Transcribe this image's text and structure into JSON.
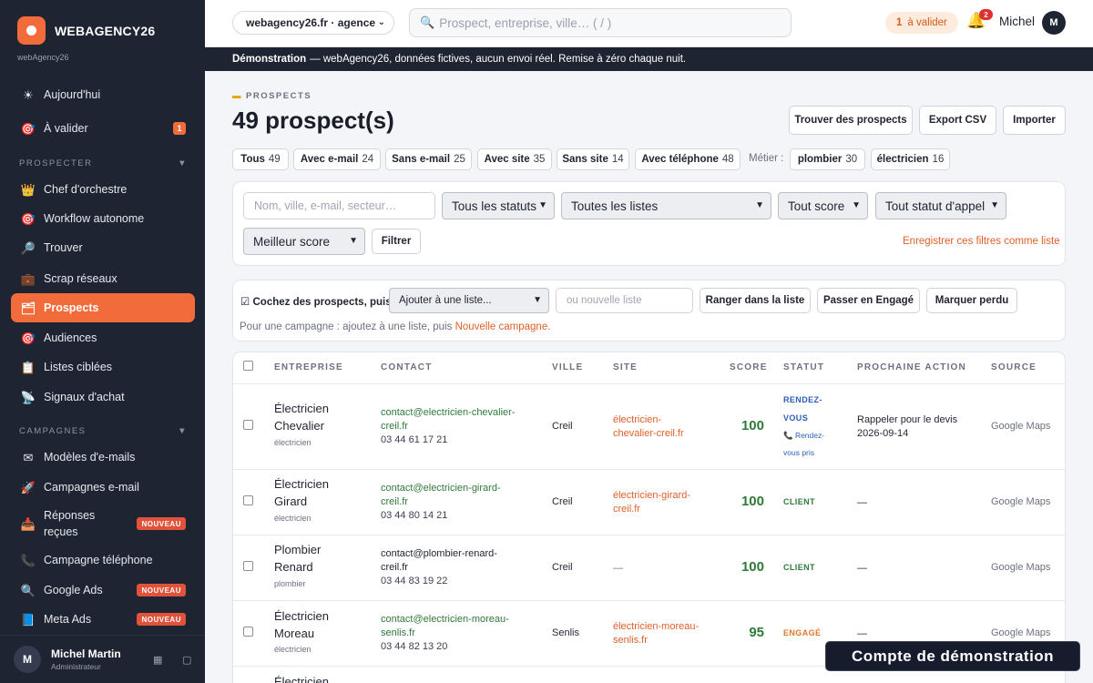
{
  "sidebar": {
    "brand": "WEBAGENCY26",
    "brand_sub": "webAgency26",
    "top_items": [
      {
        "icon": "☀",
        "label": "Aujourd'hui"
      },
      {
        "icon": "🎯",
        "label": "À valider",
        "badge": "1"
      }
    ],
    "section_prospecter": "PROSPECTER",
    "prospecter_items": [
      {
        "icon": "👑",
        "label": "Chef d'orchestre"
      },
      {
        "icon": "🎯",
        "label": "Workflow autonome"
      },
      {
        "icon": "🔎",
        "label": "Trouver"
      },
      {
        "icon": "💼",
        "label": "Scrap réseaux"
      },
      {
        "icon": "🗂",
        "label": "Prospects"
      },
      {
        "icon": "🎯",
        "label": "Audiences"
      },
      {
        "icon": "📋",
        "label": "Listes ciblées"
      },
      {
        "icon": "📡",
        "label": "Signaux d'achat"
      }
    ],
    "section_campagnes": "CAMPAGNES",
    "section_chevron": "▼",
    "campagnes_items": [
      {
        "icon": "✉",
        "label": "Modèles d'e-mails"
      },
      {
        "icon": "🚀",
        "label": "Campagnes e-mail"
      },
      {
        "icon": "📥",
        "label": "Réponses reçues",
        "badge": "NOUVEAU"
      },
      {
        "icon": "📞",
        "label": "Campagne téléphone"
      },
      {
        "icon": "🔍",
        "label": "Google Ads",
        "badge": "NOUVEAU"
      },
      {
        "icon": "📘",
        "label": "Meta Ads",
        "badge": "NOUVEAU"
      }
    ],
    "user": {
      "initial": "M",
      "name": "Michel Martin",
      "role": "Administrateur"
    }
  },
  "topbar": {
    "agency": "webagency26.fr · agence",
    "search_placeholder": "Prospect, entreprise, ville…  ( / )",
    "valider_count": "1",
    "valider_label": "à valider",
    "notif_count": "2",
    "user_name": "Michel",
    "user_initial": "M"
  },
  "demo_banner": {
    "bold": "Démonstration",
    "text": "— webAgency26, données fictives, aucun envoi réel. Remise à zéro chaque nuit."
  },
  "header": {
    "kicker": "PROSPECTS",
    "title": "49 prospect(s)",
    "actions": [
      "Trouver des prospects",
      "Export CSV",
      "Importer"
    ]
  },
  "chips": [
    {
      "label": "Tous",
      "count": "49"
    },
    {
      "label": "Avec e-mail",
      "count": "24"
    },
    {
      "label": "Sans e-mail",
      "count": "25"
    },
    {
      "label": "Avec site",
      "count": "35"
    },
    {
      "label": "Sans site",
      "count": "14"
    },
    {
      "label": "Avec téléphone",
      "count": "48"
    }
  ],
  "metier_label": "Métier :",
  "metier_chips": [
    {
      "label": "plombier",
      "count": "30"
    },
    {
      "label": "électricien",
      "count": "16"
    }
  ],
  "filters": {
    "search_placeholder": "Nom, ville, e-mail, secteur…",
    "status": "Tous les statuts",
    "lists": "Toutes les listes",
    "score": "Tout score",
    "call_status": "Tout statut d'appel",
    "sort": "Meilleur score",
    "filter_button": "Filtrer",
    "save_link": "Enregistrer ces filtres comme liste"
  },
  "bulk": {
    "label": "☑ Cochez des prospects, puis :",
    "list_select": "Ajouter à une liste...",
    "new_list_placeholder": "ou nouvelle liste",
    "actions": [
      "Ranger dans la liste",
      "Passer en Engagé",
      "Marquer perdu"
    ],
    "hint_text": "Pour une campagne : ajoutez à une liste, puis",
    "hint_link": "Nouvelle campagne."
  },
  "table": {
    "columns": [
      "ENTREPRISE",
      "CONTACT",
      "VILLE",
      "SITE",
      "SCORE",
      "STATUT",
      "PROCHAINE ACTION",
      "SOURCE"
    ],
    "rows": [
      {
        "company_l1": "Électricien",
        "company_l2": "Chevalier",
        "tag": "électricien",
        "email_l1": "contact@electricien-chevalier-",
        "email_l2": "creil.fr",
        "phone": "03 44 61 17 21",
        "city": "Creil",
        "site_l1": "électricien-",
        "site_l2": "chevalier-creil.fr",
        "score": "100",
        "status_l1": "RENDEZ-",
        "status_l2": "VOUS",
        "status_sub_l1": "📞 Rendez-",
        "status_sub_l2": "vous pris",
        "next_l1": "Rappeler pour le devis",
        "next_l2": "2026-09-14",
        "source": "Google Maps"
      },
      {
        "company_l1": "Électricien",
        "company_l2": "Girard",
        "tag": "électricien",
        "email_l1": "contact@electricien-girard-",
        "email_l2": "creil.fr",
        "phone": "03 44 80 14 21",
        "city": "Creil",
        "site_l1": "électricien-girard-",
        "site_l2": "creil.fr",
        "score": "100",
        "status": "CLIENT",
        "next": "—",
        "source": "Google Maps"
      },
      {
        "company_l1": "Plombier",
        "company_l2": "Renard",
        "tag": "plombier",
        "email_l1": "contact@plombier-renard-",
        "email_l2": "creil.fr",
        "phone": "03 44 83 19 22",
        "city": "Creil",
        "site": "—",
        "score": "100",
        "status": "CLIENT",
        "next": "—",
        "source": "Google Maps"
      },
      {
        "company_l1": "Électricien",
        "company_l2": "Moreau",
        "tag": "électricien",
        "email_l1": "contact@electricien-moreau-",
        "email_l2": "senlis.fr",
        "phone": "03 44 82 13 20",
        "city": "Senlis",
        "site_l1": "électricien-moreau-",
        "site_l2": "senlis.fr",
        "score": "95",
        "status": "ENGAGÉ",
        "next": "—",
        "source": "Google Maps"
      },
      {
        "company_l1": "Électricien"
      }
    ]
  },
  "demo_account": "Compte de démonstration",
  "colors": {
    "accent": "#f26b3a",
    "sidebar": "#1f2433",
    "green": "#2f7a3a",
    "orange_link": "#e0602a",
    "blue": "#2a5fb8",
    "engage": "#e0782a"
  }
}
